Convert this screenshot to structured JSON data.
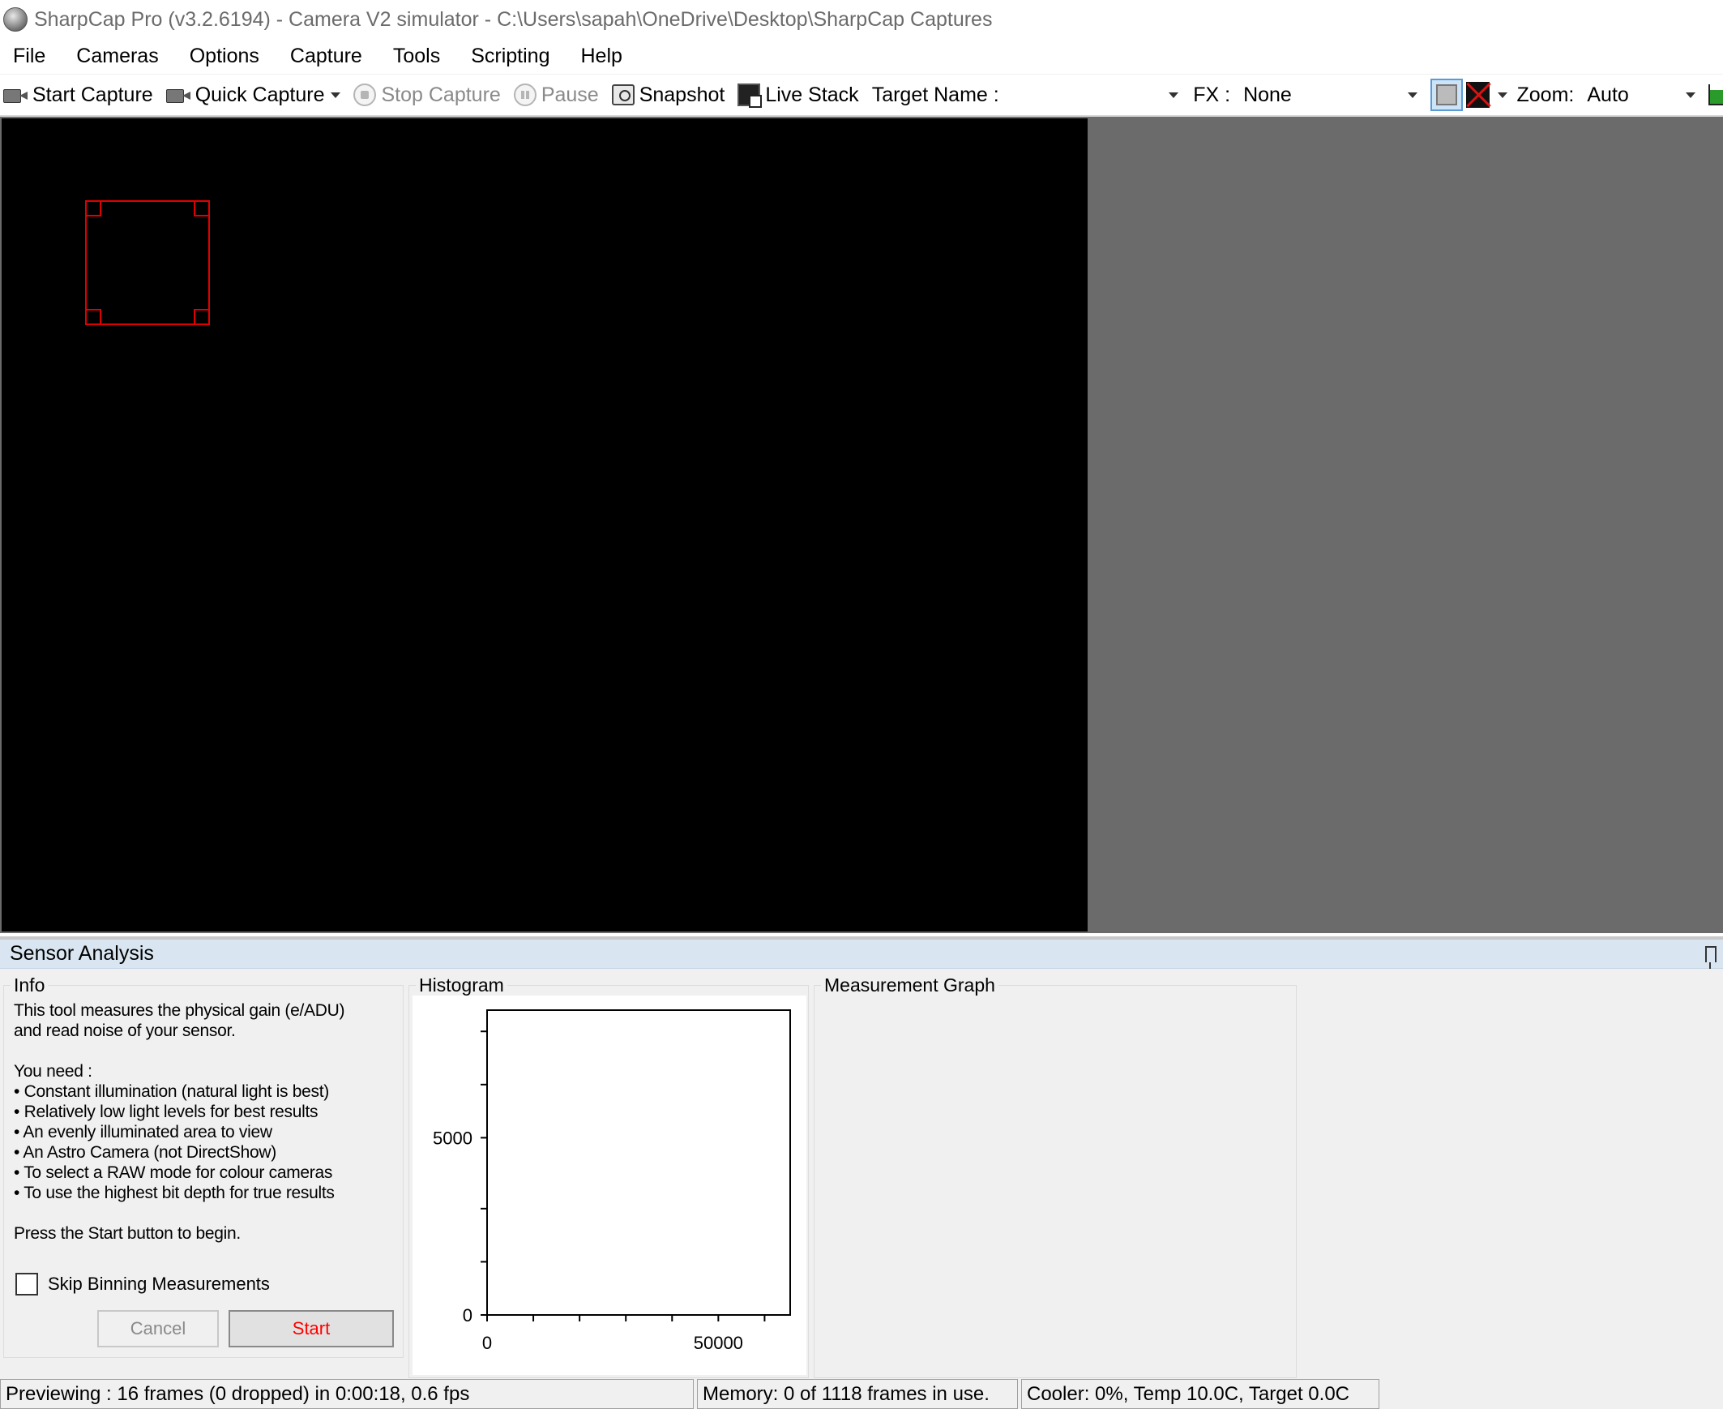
{
  "window": {
    "title": "SharpCap Pro (v3.2.6194) - Camera V2 simulator - C:\\Users\\sapah\\OneDrive\\Desktop\\SharpCap Captures"
  },
  "menu": {
    "items": [
      "File",
      "Cameras",
      "Options",
      "Capture",
      "Tools",
      "Scripting",
      "Help"
    ]
  },
  "toolbar": {
    "start_capture": "Start Capture",
    "quick_capture": "Quick Capture",
    "stop_capture": "Stop Capture",
    "pause": "Pause",
    "snapshot": "Snapshot",
    "live_stack": "Live Stack",
    "target_name_label": "Target Name :",
    "target_name_value": "",
    "fx_label": "FX :",
    "fx_value": "None",
    "zoom_label": "Zoom:",
    "zoom_value": "Auto"
  },
  "panel": {
    "title": "Sensor Analysis",
    "info": {
      "title": "Info",
      "text": "This tool measures the physical gain (e/ADU)\nand read noise of your sensor.\n\nYou need :\n• Constant illumination (natural light is best)\n• Relatively low light levels for best results\n• An evenly illuminated area to view\n• An Astro Camera (not DirectShow)\n• To select a RAW mode for colour cameras\n• To use the highest bit depth for true results\n\nPress the Start button to begin.",
      "skip_binning_label": "Skip Binning Measurements",
      "skip_binning_checked": false,
      "cancel_label": "Cancel",
      "start_label": "Start"
    },
    "histogram": {
      "title": "Histogram"
    },
    "measurement_graph": {
      "title": "Measurement Graph"
    }
  },
  "chart_data": {
    "type": "bar",
    "title": "",
    "xlabel": "",
    "ylabel": "",
    "x_tick_labels": [
      "0",
      "50000"
    ],
    "y_tick_labels": [
      "0",
      "5000"
    ],
    "xlim": [
      0,
      65535
    ],
    "ylim": [
      0,
      8600
    ],
    "x_major_ticks": [
      0,
      10000,
      20000,
      30000,
      40000,
      50000,
      60000
    ],
    "y_minor_ticks": [
      0,
      1500,
      3000,
      5000,
      6500,
      8000
    ],
    "series": [],
    "grid": false
  },
  "status": {
    "previewing": "Previewing : 16 frames (0 dropped) in 0:00:18, 0.6 fps",
    "memory": "Memory: 0 of 1118 frames in use.",
    "cooler": "Cooler: 0%, Temp 10.0C, Target 0.0C"
  },
  "colors": {
    "roi": "#e00000",
    "start_text": "#ff0000",
    "panel_header": "#d9e6f2"
  }
}
